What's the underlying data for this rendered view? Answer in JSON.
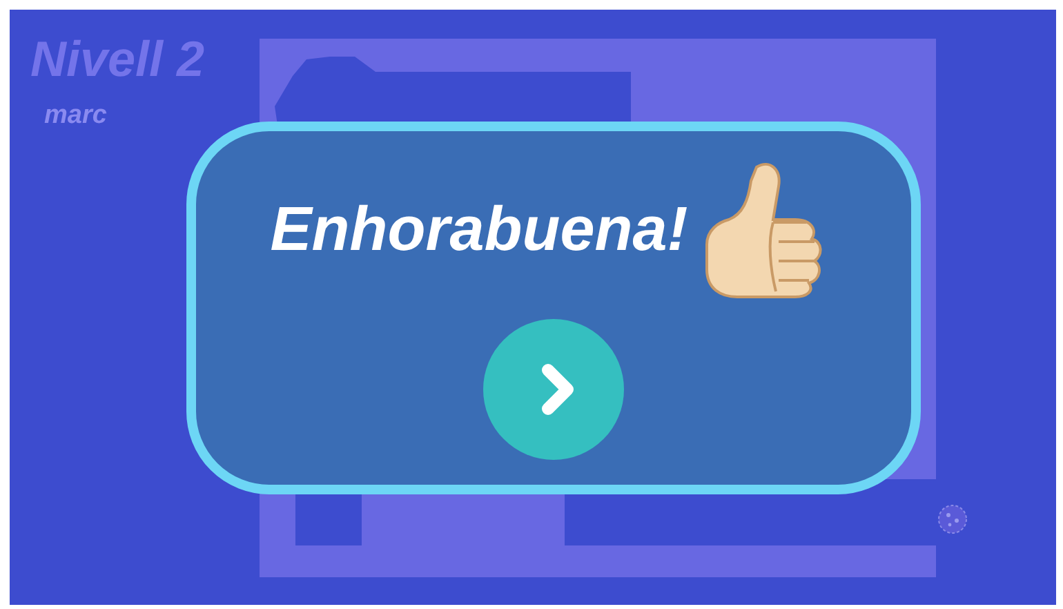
{
  "level_title": "Nivell 2",
  "player": "marc",
  "dialog": {
    "message": "Enhorabuena!"
  }
}
